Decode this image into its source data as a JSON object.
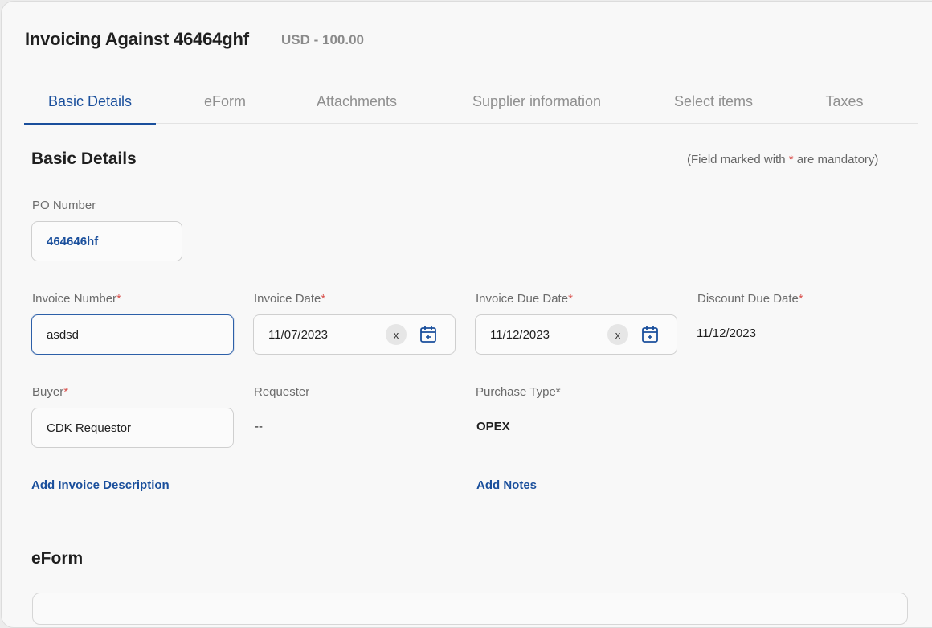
{
  "header": {
    "title": "Invoicing Against 46464ghf",
    "amount": "USD - 100.00"
  },
  "tabs": [
    {
      "label": "Basic Details",
      "active": true
    },
    {
      "label": "eForm",
      "active": false
    },
    {
      "label": "Attachments",
      "active": false
    },
    {
      "label": "Supplier information",
      "active": false
    },
    {
      "label": "Select items",
      "active": false
    },
    {
      "label": "Taxes",
      "active": false
    }
  ],
  "basic_details": {
    "heading": "Basic Details",
    "mandatory_note_prefix": "(Field marked with ",
    "mandatory_note_star": "*",
    "mandatory_note_suffix": " are mandatory)",
    "po_number": {
      "label": "PO Number",
      "value": "464646hf"
    },
    "invoice_number": {
      "label": "Invoice Number",
      "required_mark": "*",
      "value": "asdsd"
    },
    "invoice_date": {
      "label": "Invoice Date",
      "required_mark": "*",
      "value": "11/07/2023",
      "clear": "x"
    },
    "invoice_due_date": {
      "label": "Invoice Due Date",
      "required_mark": "*",
      "value": "11/12/2023",
      "clear": "x"
    },
    "discount_due_date": {
      "label": "Discount Due Date",
      "required_mark": "*",
      "value": "11/12/2023"
    },
    "buyer": {
      "label": "Buyer",
      "required_mark": "*",
      "value": "CDK Requestor"
    },
    "requester": {
      "label": "Requester",
      "value": "--"
    },
    "purchase_type": {
      "label": "Purchase Type*",
      "value": "OPEX"
    },
    "add_description_link": "Add Invoice Description",
    "add_notes_link": "Add Notes"
  },
  "eform": {
    "heading": "eForm"
  },
  "colors": {
    "accent": "#1a4f9c",
    "required": "#d9534f",
    "muted": "#8f8f8f"
  }
}
